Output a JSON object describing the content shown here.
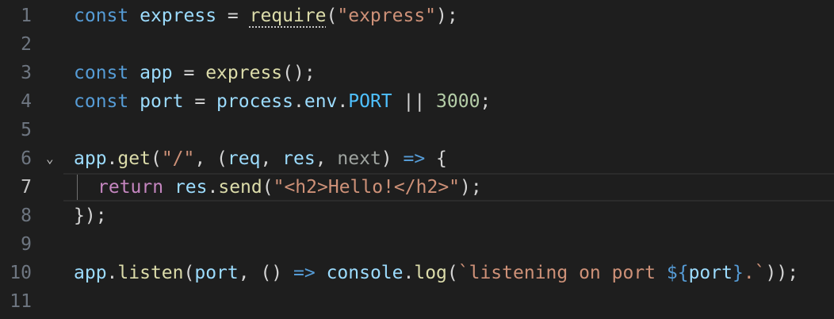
{
  "editor": {
    "line_numbers": [
      "1",
      "2",
      "3",
      "4",
      "5",
      "6",
      "7",
      "8",
      "9",
      "10",
      "11"
    ],
    "fold_marker": "⌄",
    "lines": {
      "l1": {
        "t1": "const",
        "t2": " ",
        "t3": "express",
        "t4": " = ",
        "t5": "require",
        "t6": "(",
        "t7": "\"express\"",
        "t8": ");"
      },
      "l3": {
        "t1": "const",
        "t2": " ",
        "t3": "app",
        "t4": " = ",
        "t5": "express",
        "t6": "();"
      },
      "l4": {
        "t1": "const",
        "t2": " ",
        "t3": "port",
        "t4": " = ",
        "t5": "process",
        "t6": ".",
        "t7": "env",
        "t8": ".",
        "t9": "PORT",
        "t10": " || ",
        "t11": "3000",
        "t12": ";"
      },
      "l6": {
        "t1": "app",
        "t2": ".",
        "t3": "get",
        "t4": "(",
        "t5": "\"/\"",
        "t6": ", (",
        "t7": "req",
        "t8": ", ",
        "t9": "res",
        "t10": ", ",
        "t11": "next",
        "t12": ") ",
        "t13": "=>",
        "t14": " {"
      },
      "l7": {
        "t1": "return",
        "t2": " ",
        "t3": "res",
        "t4": ".",
        "t5": "send",
        "t6": "(",
        "t7": "\"<h2>Hello!</h2>\"",
        "t8": ");"
      },
      "l8": {
        "t1": "});"
      },
      "l10": {
        "t1": "app",
        "t2": ".",
        "t3": "listen",
        "t4": "(",
        "t5": "port",
        "t6": ", () ",
        "t7": "=>",
        "t8": " ",
        "t9": "console",
        "t10": ".",
        "t11": "log",
        "t12": "(",
        "t13": "`listening on port ",
        "t14": "${",
        "t15": "port",
        "t16": "}",
        "t17": ".`",
        "t18": "));"
      }
    }
  },
  "colors": {
    "background": "#1e1e1e",
    "keyword": "#569cd6",
    "control_keyword": "#c586c0",
    "function": "#dcdcaa",
    "string": "#ce9178",
    "number": "#b5cea8",
    "variable": "#9cdcfe",
    "constant": "#4fc1ff",
    "line_number": "#6e7681"
  }
}
